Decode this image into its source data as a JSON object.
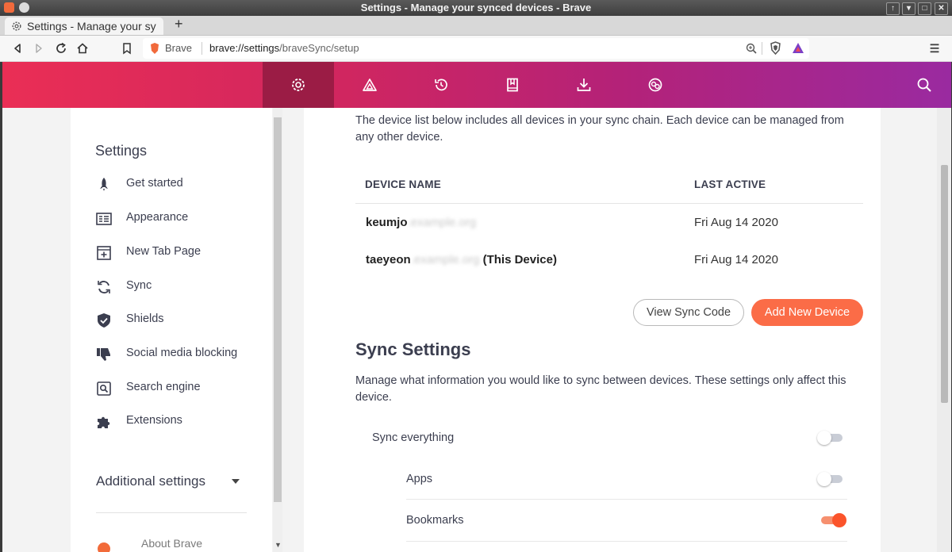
{
  "window": {
    "title": "Settings - Manage your synced devices - Brave"
  },
  "tab": {
    "title": "Settings - Manage your sy",
    "new_tab": "+"
  },
  "address_bar": {
    "site_label": "Brave",
    "url_host": "brave://settings",
    "url_path": "/braveSync/setup"
  },
  "topnav": {
    "items": [
      "settings-icon",
      "rewards-icon",
      "history-icon",
      "bookmarks-icon",
      "downloads-icon",
      "wallet-icon"
    ],
    "active": "settings-icon"
  },
  "sidebar": {
    "heading": "Settings",
    "items": [
      {
        "label": "Get started",
        "icon": "rocket-icon"
      },
      {
        "label": "Appearance",
        "icon": "appearance-icon"
      },
      {
        "label": "New Tab Page",
        "icon": "new-tab-page-icon"
      },
      {
        "label": "Sync",
        "icon": "sync-icon"
      },
      {
        "label": "Shields",
        "icon": "shield-icon"
      },
      {
        "label": "Social media blocking",
        "icon": "thumbs-down-icon"
      },
      {
        "label": "Search engine",
        "icon": "search-engine-icon"
      },
      {
        "label": "Extensions",
        "icon": "puzzle-icon"
      }
    ],
    "additional": "Additional settings",
    "about": "About Brave"
  },
  "sync": {
    "intro": "The device list below includes all devices in your sync chain. Each device can be managed from any other device.",
    "columns": {
      "name": "DEVICE NAME",
      "last_active": "LAST ACTIVE"
    },
    "devices": [
      {
        "name_visible": "keumjo",
        "name_hidden": ".example.org",
        "suffix": "",
        "last_active": "Fri Aug 14 2020"
      },
      {
        "name_visible": "taeyeon",
        "name_hidden": ".example.org",
        "suffix": " (This Device)",
        "last_active": "Fri Aug 14 2020"
      }
    ],
    "view_code_label": "View Sync Code",
    "add_device_label": "Add New Device",
    "settings_heading": "Sync Settings",
    "settings_desc": "Manage what information you would like to sync between devices. These settings only affect this device.",
    "options": [
      {
        "label": "Sync everything",
        "enabled": false
      },
      {
        "label": "Apps",
        "enabled": false
      },
      {
        "label": "Bookmarks",
        "enabled": true
      }
    ]
  },
  "colors": {
    "accent": "#fb542b",
    "button_orange": "#fb6c47",
    "nav_active": "#9b1c45"
  }
}
